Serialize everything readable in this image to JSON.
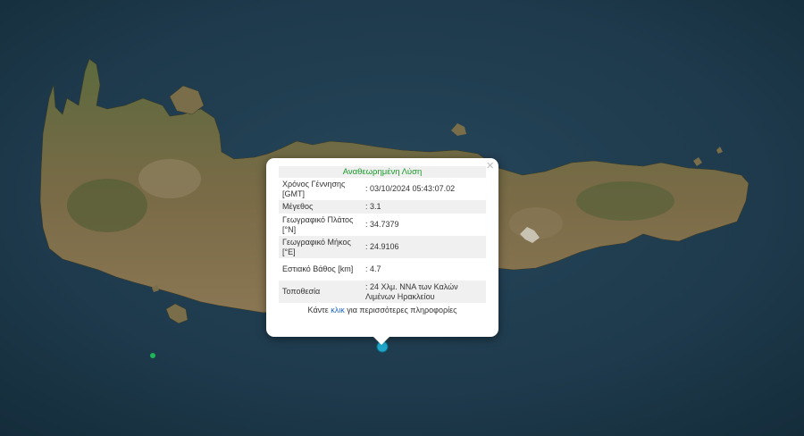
{
  "popup": {
    "title": "Αναθεωρημένη Λύση",
    "close_label": "×",
    "rows": [
      {
        "key": "Χρόνος Γέννησης [GMT]",
        "value": ": 03/10/2024 05:43:07.02"
      },
      {
        "key": "Μέγεθος",
        "value": ": 3.1"
      },
      {
        "key": "Γεωγραφικό Πλάτος [°N]",
        "value": ": 34.7379"
      },
      {
        "key": "Γεωγραφικό Μήκος [°E]",
        "value": ": 24.9106"
      },
      {
        "key": "Εστιακό Βάθος [km]",
        "value": ": 4.7"
      },
      {
        "key": "Τοποθεσία",
        "value": ": 24 Χλμ. ΝΝΑ των Καλών Λιμένων Ηρακλείου"
      }
    ],
    "more_prefix": "Κάντε ",
    "more_link": "κλικ",
    "more_suffix": " για περισσότερες πληροφορίες"
  },
  "colors": {
    "sea": "#1f3a4a",
    "land": "#6b6440",
    "event_marker": "#1fa6c9",
    "minor_marker": "#1fb35a",
    "popup_title": "#1a9a2a",
    "link": "#1e66c6"
  }
}
